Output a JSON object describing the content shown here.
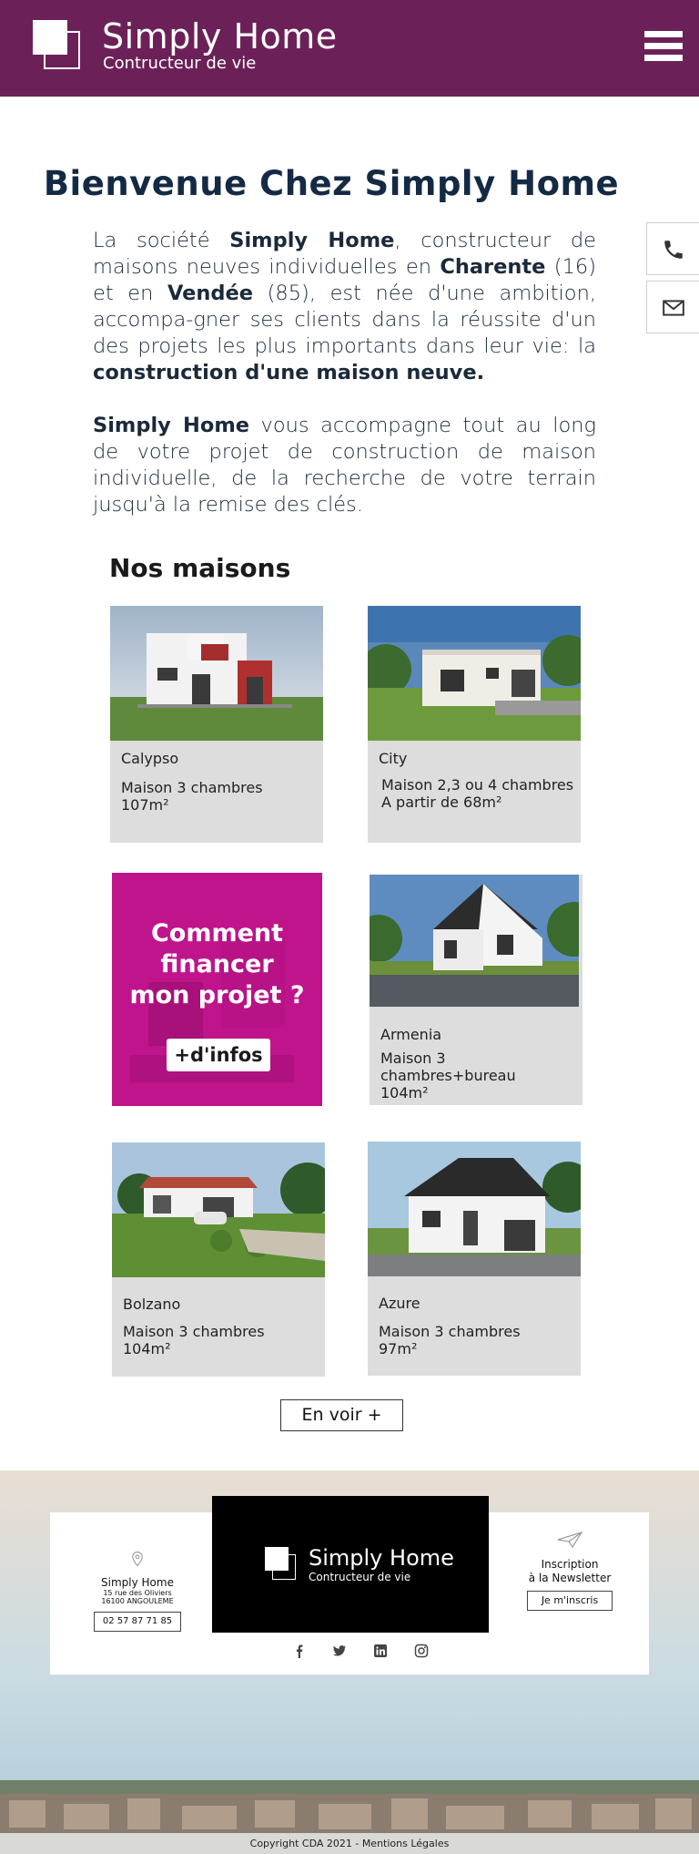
{
  "header": {
    "brand_title": "Simply Home",
    "brand_subtitle": "Contructeur de vie",
    "menu_icon": "hamburger-menu-icon",
    "color": "#6b2157"
  },
  "side_buttons": [
    {
      "icon": "phone-icon"
    },
    {
      "icon": "mail-icon"
    }
  ],
  "intro": {
    "title": "Bienvenue Chez Simply Home",
    "p1_a": "La société ",
    "p1_b": "Simply Home",
    "p1_c": ", constructeur de maisons neuves individuelles en ",
    "p1_d": "Charente",
    "p1_e": " (16) et en ",
    "p1_f": "Vendée",
    "p1_g": " (85), est née d'une ambition, accompa-gner ses clients dans la réussite d'un des projets les plus importants dans leur vie: la ",
    "p1_h": "construction d'une maison neuve.",
    "p2_a": "Simply Home",
    "p2_b": " vous accompagne tout au long de votre projet de construction de maison individuelle, de la recherche de votre terrain jusqu'à la remise des clés."
  },
  "houses": {
    "title": "Nos maisons",
    "items": [
      {
        "name": "Calypso",
        "desc1": "Maison 3 chambres",
        "desc2": "107m²"
      },
      {
        "name": "City",
        "desc1": "Maison 2,3 ou 4 chambres",
        "desc2": "A partir de 68m²"
      },
      {
        "name": "Armenia",
        "desc1": "Maison 3 chambres+bureau",
        "desc2": "104m²"
      },
      {
        "name": "Bolzano",
        "desc1": "Maison 3 chambres",
        "desc2": "104m²"
      },
      {
        "name": "Azure",
        "desc1": "Maison 3 chambres",
        "desc2": "97m²"
      }
    ],
    "promo": {
      "line1": "Comment",
      "line2": "financer",
      "line3": "mon projet ?",
      "button": "+d'infos",
      "color": "#c0148c"
    },
    "see_more": "En voir +"
  },
  "footer": {
    "address_name": "Simply Home",
    "address_line1": "15 rue des Oliviers",
    "address_line2": "16100 ANGOULEME",
    "phone": "02 57 87 71 85",
    "logo_title": "Simply Home",
    "logo_subtitle": "Contructeur de vie",
    "newsletter_line1": "Inscription",
    "newsletter_line2": "à la Newsletter",
    "newsletter_button": "Je m'inscris",
    "social": [
      "facebook-icon",
      "twitter-icon",
      "linkedin-icon",
      "instagram-icon"
    ],
    "copyright": "Copyright CDA 2021 - Mentions Légales"
  }
}
